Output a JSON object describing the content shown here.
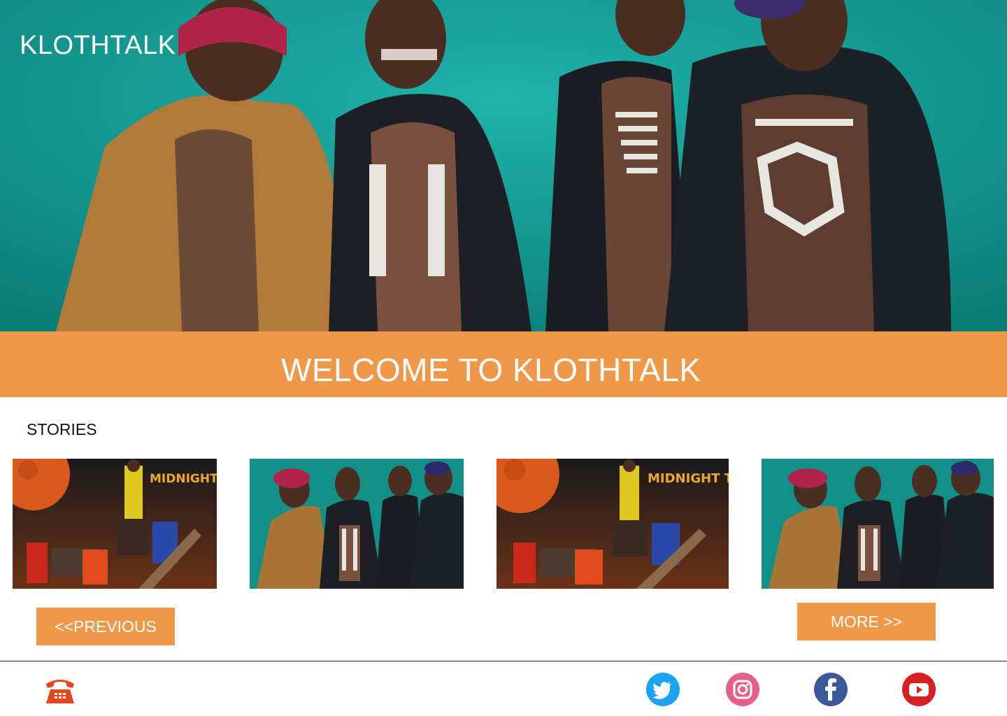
{
  "header": {
    "brand": "KLOTHTALK",
    "hero_image": "four-men-teal-backdrop-photo"
  },
  "welcome": {
    "title": "WELCOME TO KLOTHTALK"
  },
  "stories": {
    "label": "STORIES",
    "items": [
      {
        "image": "midnight-train-album-cover",
        "overlay_text": "MIDNIGHT TRAIN"
      },
      {
        "image": "four-men-teal-backdrop-photo"
      },
      {
        "image": "midnight-train-album-cover",
        "overlay_text": "MIDNIGHT TRAIN"
      },
      {
        "image": "four-men-teal-backdrop-photo"
      }
    ],
    "prev_label": "<<PREVIOUS",
    "more_label": "MORE >>"
  },
  "footer": {
    "icons": [
      "telephone-icon",
      "twitter-icon",
      "instagram-icon",
      "facebook-icon",
      "youtube-icon"
    ]
  },
  "colors": {
    "accent": "#f0984a",
    "hero_bg": "#12958f",
    "text_white": "#ffffff"
  }
}
